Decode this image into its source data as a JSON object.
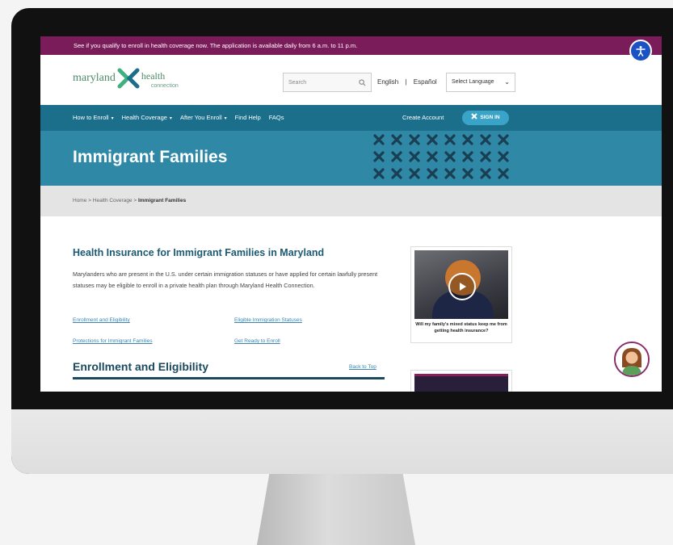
{
  "announcement": "See if you qualify to enroll in health coverage now. The application is available daily from 6 a.m. to 11 p.m.",
  "logo": {
    "word1": "maryland",
    "word2": "health",
    "word3": "connection"
  },
  "search": {
    "placeholder": "Search"
  },
  "languages": {
    "english": "English",
    "separator": "|",
    "spanish": "Español",
    "select": "Select Language"
  },
  "nav": {
    "items": [
      {
        "label": "How to Enroll",
        "caret": "▾"
      },
      {
        "label": "Health Coverage",
        "caret": "▾"
      },
      {
        "label": "After You Enroll",
        "caret": "▾"
      },
      {
        "label": "Find Help",
        "caret": ""
      },
      {
        "label": "FAQs",
        "caret": ""
      }
    ],
    "create_account": "Create Account",
    "sign_in": "SIGN IN"
  },
  "hero": {
    "title": "Immigrant Families"
  },
  "breadcrumb": {
    "home": "Home",
    "sep": ">",
    "section": "Health Coverage",
    "current": "Immigrant Families"
  },
  "main": {
    "heading": "Health Insurance for Immigrant Families in Maryland",
    "intro": "Marylanders who are present in the U.S. under certain immigration statuses or have applied for certain lawfully present statuses may be eligible to enroll in a private health plan through Maryland Health Connection.",
    "links": [
      "Enrollment and Eligibility",
      "Eligible Immigration Statuses",
      "Protections for Immigrant Families",
      "Get Ready to Enroll"
    ],
    "section_title": "Enrollment and Eligibility",
    "back_to_top": "Back to Top"
  },
  "video": {
    "caption": "Will my family's mixed status keep me from getting health insurance?"
  },
  "colors": {
    "announce": "#7a1b5a",
    "nav": "#1b6f8a",
    "hero": "#2e88a6",
    "accent_green": "#3fb07f"
  }
}
